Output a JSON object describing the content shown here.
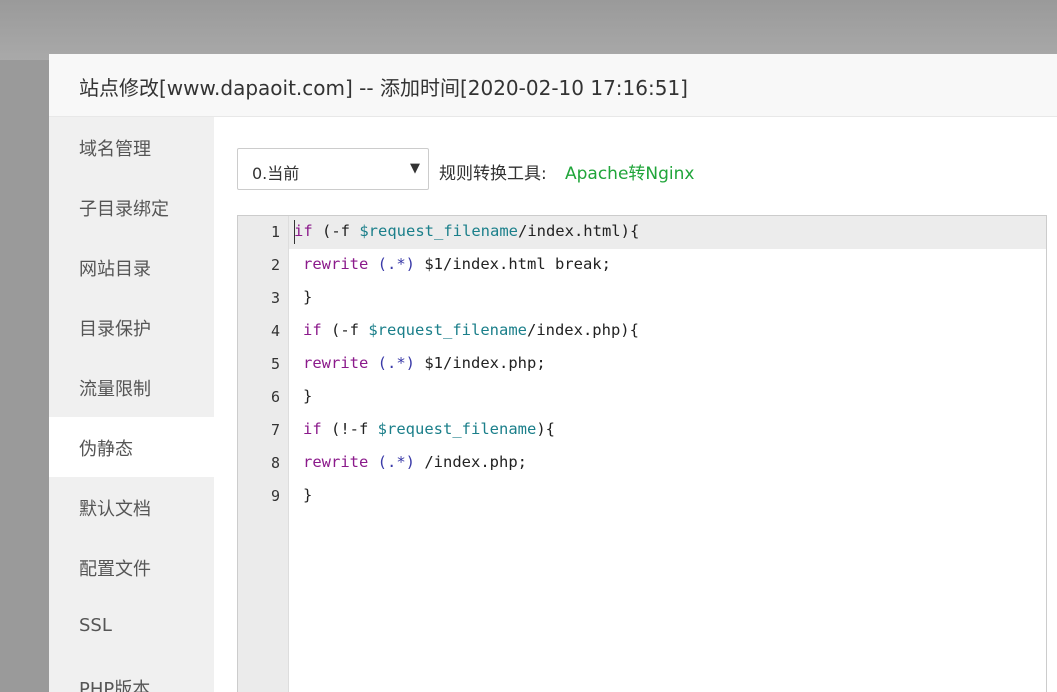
{
  "dialog": {
    "title": "站点修改[www.dapaoit.com] -- 添加时间[2020-02-10 17:16:51]"
  },
  "sidebar": {
    "items": [
      {
        "label": "域名管理"
      },
      {
        "label": "子目录绑定"
      },
      {
        "label": "网站目录"
      },
      {
        "label": "目录保护"
      },
      {
        "label": "流量限制"
      },
      {
        "label": "伪静态",
        "active": true
      },
      {
        "label": "默认文档"
      },
      {
        "label": "配置文件"
      },
      {
        "label": "SSL"
      },
      {
        "label": "PHP版本"
      }
    ]
  },
  "rewrite": {
    "select_value": "0.当前",
    "tool_label": "规则转换工具:",
    "tool_link": "Apache转Nginx"
  },
  "editor": {
    "line_numbers": [
      "1",
      "2",
      "3",
      "4",
      "5",
      "6",
      "7",
      "8",
      "9"
    ],
    "lines": [
      "if (-f $request_filename/index.html){",
      "rewrite (.*) $1/index.html break;",
      "}",
      "if (-f $request_filename/index.php){",
      "rewrite (.*) $1/index.php;",
      "}",
      "if (!-f $request_filename){",
      "rewrite (.*) /index.php;",
      "}"
    ]
  },
  "colors": {
    "accent_green": "#20a53a",
    "keyword": "#8b1a8b",
    "variable": "#1b7f8a"
  }
}
